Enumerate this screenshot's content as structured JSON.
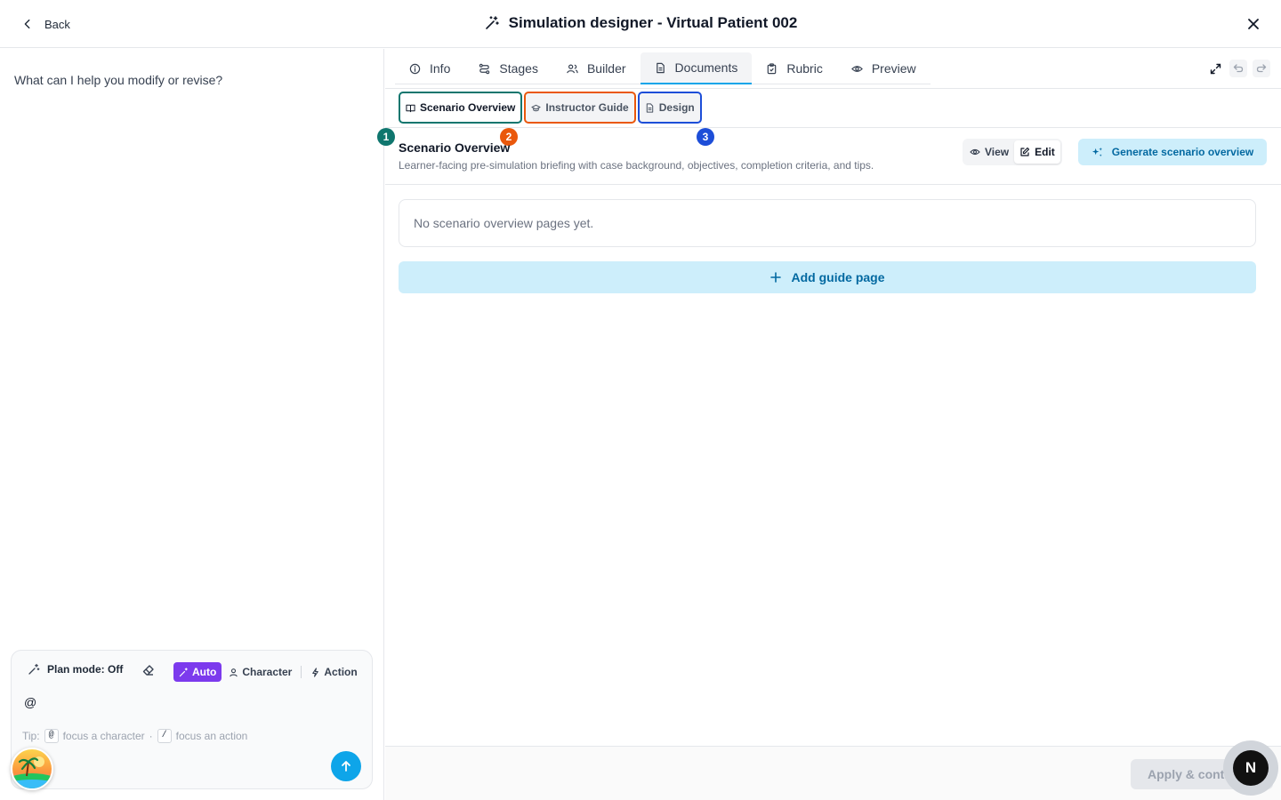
{
  "header": {
    "back_label": "Back",
    "title": "Simulation designer - Virtual Patient 002"
  },
  "assistant": {
    "prompt": "What can I help you modify or revise?",
    "plan_mode_label": "Plan mode: Off",
    "modes": [
      "Auto",
      "Character",
      "Action"
    ],
    "active_mode": "Auto",
    "input_value": "@",
    "tip_label": "Tip:",
    "tip_key_1": "@",
    "tip_text_1": "focus a character",
    "tip_dot": "·",
    "tip_key_2": "/",
    "tip_text_2": "focus an action"
  },
  "tabs": [
    {
      "label": "Info",
      "icon": "info-icon"
    },
    {
      "label": "Stages",
      "icon": "stages-icon"
    },
    {
      "label": "Builder",
      "icon": "users-icon"
    },
    {
      "label": "Documents",
      "icon": "document-icon"
    },
    {
      "label": "Rubric",
      "icon": "clipboard-icon"
    },
    {
      "label": "Preview",
      "icon": "eye-icon"
    }
  ],
  "active_tab": "Documents",
  "subtabs": [
    {
      "label": "Scenario Overview",
      "badge": "1",
      "color": "#0f766e"
    },
    {
      "label": "Instructor Guide",
      "badge": "2",
      "color": "#ea580c"
    },
    {
      "label": "Design",
      "badge": "3",
      "color": "#1d4ed8"
    }
  ],
  "section": {
    "title": "Scenario Overview",
    "subtitle": "Learner-facing pre-simulation briefing with case background, objectives, completion criteria, and tips.",
    "view_label": "View",
    "edit_label": "Edit",
    "generate_label": "Generate scenario overview",
    "empty_message": "No scenario overview pages yet.",
    "add_label": "Add guide page"
  },
  "footer": {
    "apply_label": "Apply & continue"
  },
  "floating": {
    "n_label": "N"
  },
  "colors": {
    "accent": "#0ea5e9",
    "mode_active": "#7c3aed",
    "light_blue_button": "#cdeefb"
  }
}
